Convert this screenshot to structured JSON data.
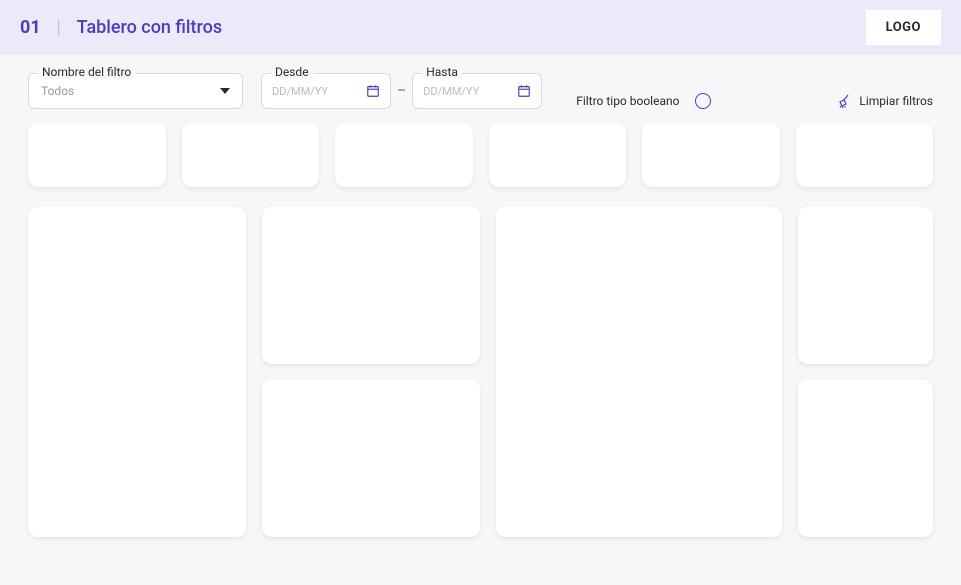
{
  "header": {
    "page_number": "01",
    "title": "Tablero con filtros",
    "logo": "LOGO"
  },
  "filters": {
    "select": {
      "label": "Nombre del filtro",
      "value": "Todos"
    },
    "date_from": {
      "label": "Desde",
      "placeholder": "DD/MM/YY"
    },
    "date_to": {
      "label": "Hasta",
      "placeholder": "DD/MM/YY"
    },
    "date_separator": "–",
    "boolean": {
      "label": "Filtro tipo booleano"
    },
    "clear": {
      "label": "Limpiar filtros"
    }
  }
}
